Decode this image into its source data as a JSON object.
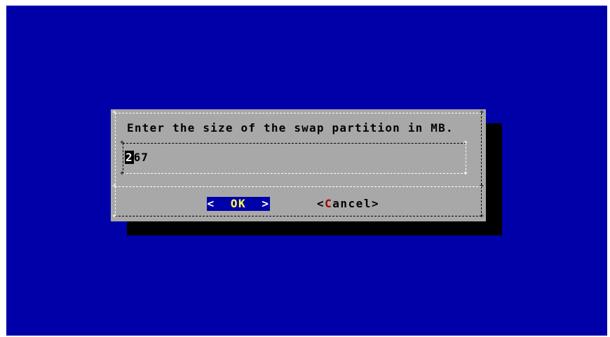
{
  "dialog": {
    "prompt": "Enter the size of the swap partition in MB.",
    "input": {
      "cursor_char": "2",
      "rest_value": "67"
    },
    "buttons": {
      "ok": {
        "left_bracket": "<",
        "hotkey": "O",
        "rest": "K",
        "right_bracket": ">"
      },
      "cancel": {
        "left_bracket": "<",
        "hotkey": "C",
        "rest": "ancel",
        "right_bracket": ">"
      }
    }
  },
  "colors": {
    "background": "#0000a8",
    "dialog": "#a8a8a8",
    "shadow": "#000000",
    "selected_button": "#0000a8",
    "hotkey_selected": "#ffff55",
    "hotkey_unselected": "#a80000"
  }
}
